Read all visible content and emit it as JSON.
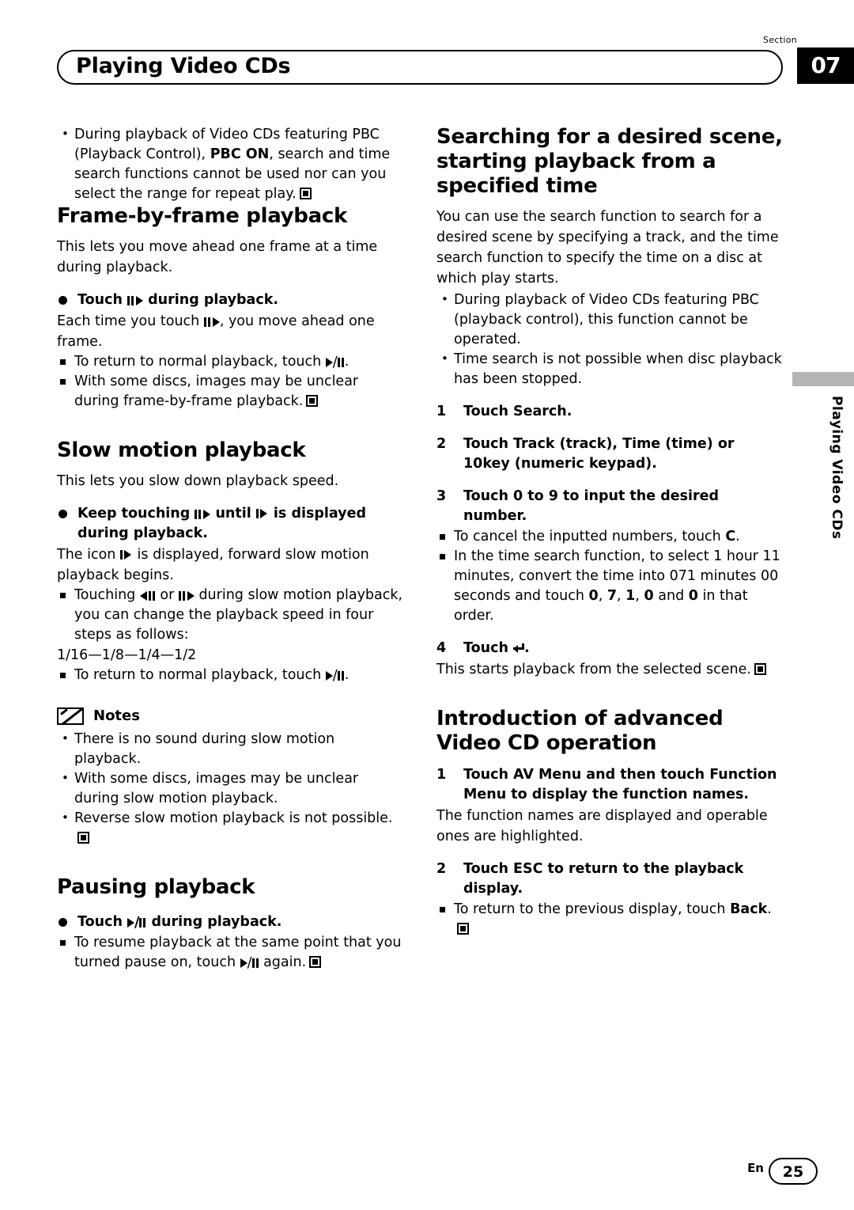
{
  "header": {
    "section_label": "Section",
    "section_number": "07",
    "title": "Playing Video CDs"
  },
  "side_tab": {
    "label": "Playing Video CDs"
  },
  "left_column": {
    "intro_bullet": {
      "part1": "During playback of Video CDs featuring PBC (Playback Control), ",
      "bold": "PBC ON",
      "part2": ", search and time search functions cannot be used nor can you select the range for repeat play."
    },
    "frame_heading": "Frame-by-frame playback",
    "frame_body": "This lets you move ahead one frame at a time during playback.",
    "frame_step_pre": "Touch ",
    "frame_step_post": " during playback.",
    "frame_after_1": "Each time you touch ",
    "frame_after_2": ", you move ahead one frame.",
    "frame_sub1_pre": "To return to normal playback, touch ",
    "frame_sub1_post": ".",
    "frame_sub2": "With some discs, images may be unclear during frame-by-frame playback.",
    "slow_heading": "Slow motion playback",
    "slow_body": "This lets you slow down playback speed.",
    "slow_step_a": "Keep touching ",
    "slow_step_b": " until ",
    "slow_step_c": " is displayed during playback.",
    "slow_after_a": "The icon ",
    "slow_after_b": " is displayed, forward slow motion playback begins.",
    "slow_sub1_a": "Touching ",
    "slow_sub1_b": " or ",
    "slow_sub1_c": " during slow motion playback, you can change the playback speed in four steps as follows:",
    "slow_speeds": "1/16—1/8—1/4—1/2",
    "slow_sub2_pre": "To return to normal playback, touch ",
    "slow_sub2_post": ".",
    "notes_label": "Notes",
    "notes": [
      "There is no sound during slow motion playback.",
      "With some discs, images may be unclear during slow motion playback.",
      "Reverse slow motion playback is not possible."
    ],
    "pause_heading": "Pausing playback",
    "pause_step_pre": "Touch ",
    "pause_step_post": " during playback.",
    "pause_sub_pre": "To resume playback at the same point that you turned pause on, touch ",
    "pause_sub_post": " again."
  },
  "right_column": {
    "search_heading": "Searching for a desired scene, starting playback from a specified time",
    "search_body": "You can use the search function to search for a desired scene by specifying a track, and the time search function to specify the time on a disc at which play starts.",
    "search_bullets": [
      "During playback of Video CDs featuring PBC (playback control), this function cannot be operated.",
      "Time search is not possible when disc playback has been stopped."
    ],
    "step1_num": "1",
    "step1": "Touch Search.",
    "step2_num": "2",
    "step2": "Touch Track (track), Time (time) or 10key (numeric keypad).",
    "step3_num": "3",
    "step3": "Touch 0 to 9 to input the desired number.",
    "step3_sub1_pre": "To cancel the inputted numbers, touch ",
    "step3_sub1_bold": "C",
    "step3_sub1_post": ".",
    "step3_sub2_a": "In the time search function, to select 1 hour 11 minutes, convert the time into 071 minutes 00 seconds and touch ",
    "step3_sub2_nums": [
      "0",
      "7",
      "1",
      "0",
      "0"
    ],
    "step3_sub2_b": " and ",
    "step3_sub2_c": " in that order.",
    "step4_num": "4",
    "step4_pre": "Touch ",
    "step4_post": ".",
    "step4_body": "This starts playback from the selected scene.",
    "intro_heading": "Introduction of advanced Video CD operation",
    "adv_step1_num": "1",
    "adv_step1": "Touch AV Menu and then touch Function Menu to display the function names.",
    "adv_step1_body": "The function names are displayed and operable ones are highlighted.",
    "adv_step2_num": "2",
    "adv_step2": "Touch ESC to return to the playback display.",
    "adv_step2_sub_pre": "To return to the previous display, touch ",
    "adv_step2_sub_bold": "Back",
    "adv_step2_sub_post": "."
  },
  "footer": {
    "lang": "En",
    "page": "25"
  }
}
